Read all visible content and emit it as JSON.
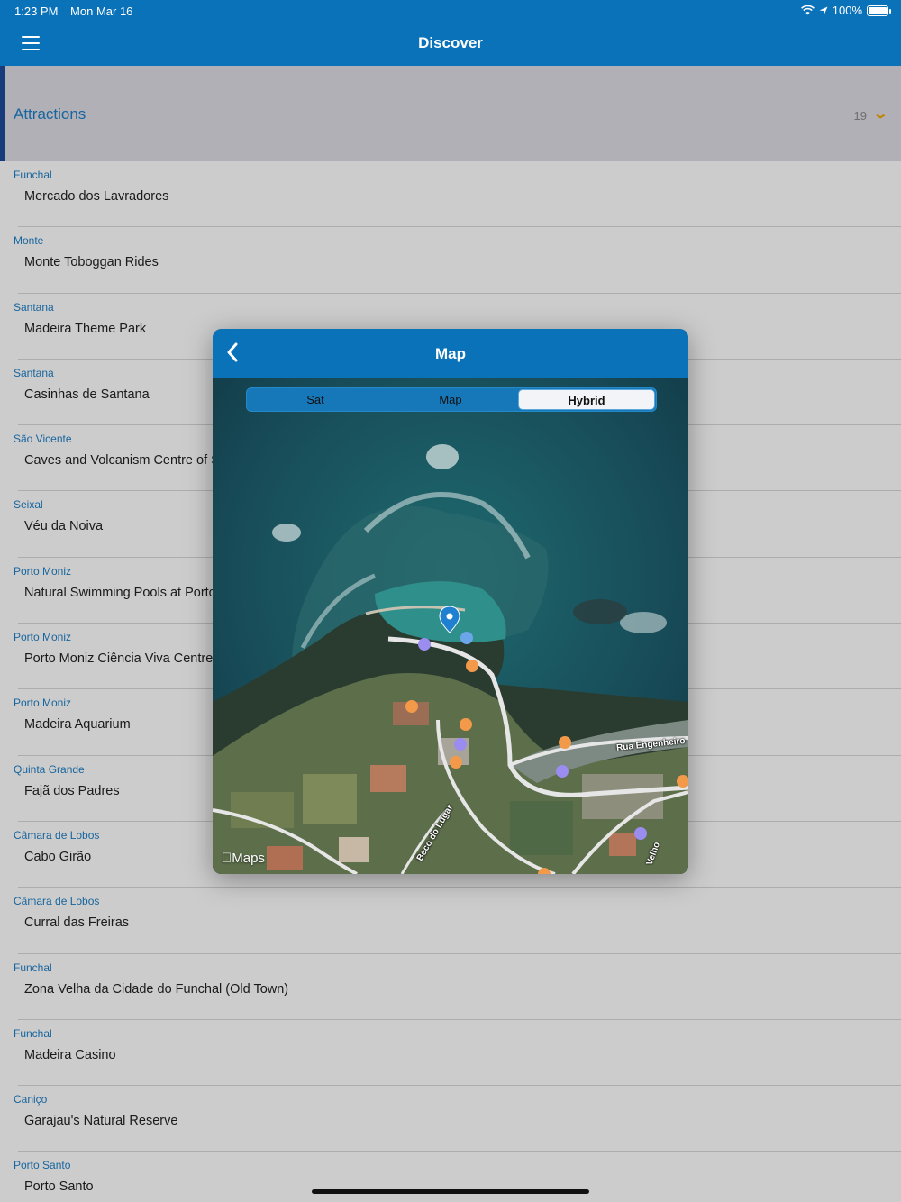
{
  "status_bar": {
    "time": "1:23 PM",
    "date": "Mon Mar 16",
    "battery": "100%"
  },
  "nav": {
    "title": "Discover",
    "menu_icon": "hamburger-menu-icon"
  },
  "section": {
    "label": "Attractions",
    "count": "19"
  },
  "attractions": [
    {
      "location": "Funchal",
      "name": "Mercado dos Lavradores"
    },
    {
      "location": "Monte",
      "name": "Monte Toboggan Rides"
    },
    {
      "location": "Santana",
      "name": "Madeira Theme Park"
    },
    {
      "location": "Santana",
      "name": "Casinhas de Santana"
    },
    {
      "location": "São Vicente",
      "name": "Caves and Volcanism Centre of S"
    },
    {
      "location": "Seixal",
      "name": "Véu da Noiva"
    },
    {
      "location": "Porto Moniz",
      "name": "Natural Swimming Pools at Porto"
    },
    {
      "location": "Porto Moniz",
      "name": "Porto Moniz Ciência Viva Centre"
    },
    {
      "location": "Porto Moniz",
      "name": "Madeira Aquarium"
    },
    {
      "location": "Quinta Grande",
      "name": "Fajã dos Padres"
    },
    {
      "location": "Câmara de Lobos",
      "name": "Cabo Girão"
    },
    {
      "location": "Câmara de Lobos",
      "name": "Curral das Freiras"
    },
    {
      "location": "Funchal",
      "name": "Zona Velha da Cidade do Funchal (Old Town)"
    },
    {
      "location": "Funchal",
      "name": "Madeira Casino"
    },
    {
      "location": "Caniço",
      "name": "Garajau's Natural Reserve"
    },
    {
      "location": "Porto Santo",
      "name": "Porto Santo"
    }
  ],
  "modal": {
    "title": "Map",
    "back_icon": "chevron-left-icon",
    "map_types": [
      "Sat",
      "Map",
      "Hybrid"
    ],
    "selected_map_type": "Hybrid",
    "attribution": "Maps",
    "road_labels": [
      "Rua Engenheiro",
      "Beco do Lugar",
      "Velho"
    ]
  },
  "colors": {
    "nav_blue": "#0a72b9",
    "link_blue": "#1d7fc6",
    "accent_orange": "#f0a800",
    "section_bar": "#1e4a9a"
  }
}
